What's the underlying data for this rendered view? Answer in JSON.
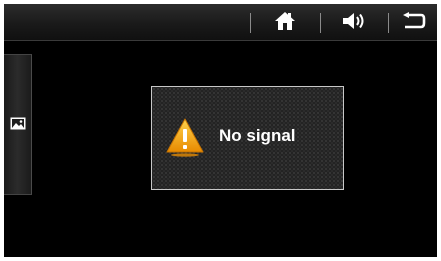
{
  "topbar": {
    "home_icon": "home-icon",
    "volume_icon": "volume-icon",
    "back_icon": "back-icon"
  },
  "sidebar": {
    "icon": "image-icon"
  },
  "dialog": {
    "icon": "warning-icon",
    "message": "No signal",
    "colors": {
      "warning_fill": "#f2a400",
      "border": "#c8c8c8"
    }
  }
}
